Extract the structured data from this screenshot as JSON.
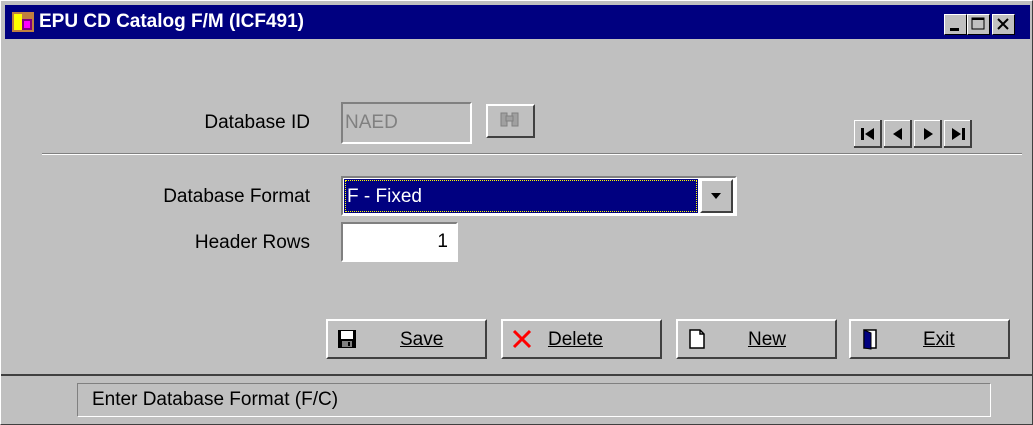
{
  "window": {
    "title": "EPU CD Catalog F/M (ICF491)"
  },
  "title_controls": [
    {
      "name": "minimize-button",
      "icon": "minimize-icon"
    },
    {
      "name": "maximize-button",
      "icon": "maximize-icon"
    },
    {
      "name": "close-button",
      "icon": "close-icon"
    }
  ],
  "form": {
    "database_id_label": "Database ID",
    "database_id_value": "NAED",
    "database_format_label": "Database Format",
    "database_format_value": "F - Fixed",
    "header_rows_label": "Header Rows",
    "header_rows_value": "1"
  },
  "record_nav": [
    "first-record-icon",
    "previous-record-icon",
    "next-record-icon",
    "last-record-icon"
  ],
  "buttons": {
    "save": "Save",
    "delete": "Delete",
    "new": "New",
    "exit": "Exit"
  },
  "status_bar": {
    "text": "Enter Database Format (F/C)"
  },
  "colors": {
    "title_bar": "#000080",
    "face": "#c0c0c0",
    "selection": "#000080",
    "delete_icon": "#ff0000"
  }
}
